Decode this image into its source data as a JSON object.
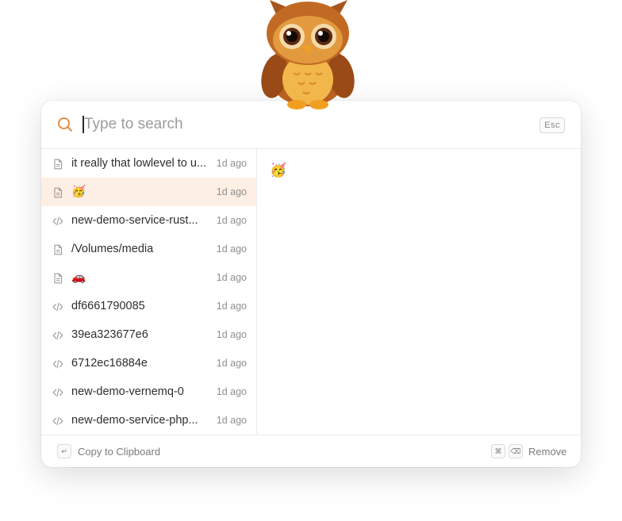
{
  "search": {
    "placeholder": "Type to search",
    "value": "",
    "esc_key": "Esc"
  },
  "list": {
    "items": [
      {
        "icon": "document-icon",
        "label": "it really that lowlevel to u...",
        "time": "1d ago",
        "selected": false
      },
      {
        "icon": "document-icon",
        "label": "🥳",
        "time": "1d ago",
        "selected": true
      },
      {
        "icon": "code-icon",
        "label": "new-demo-service-rust...",
        "time": "1d ago",
        "selected": false
      },
      {
        "icon": "document-icon",
        "label": "/Volumes/media",
        "time": "1d ago",
        "selected": false
      },
      {
        "icon": "document-icon",
        "label": "🚗",
        "time": "1d ago",
        "selected": false
      },
      {
        "icon": "code-icon",
        "label": "df6661790085",
        "time": "1d ago",
        "selected": false
      },
      {
        "icon": "code-icon",
        "label": "39ea323677e6",
        "time": "1d ago",
        "selected": false
      },
      {
        "icon": "code-icon",
        "label": "6712ec16884e",
        "time": "1d ago",
        "selected": false
      },
      {
        "icon": "code-icon",
        "label": "new-demo-vernemq-0",
        "time": "1d ago",
        "selected": false
      },
      {
        "icon": "code-icon",
        "label": "new-demo-service-php...",
        "time": "1d ago",
        "selected": false
      }
    ]
  },
  "preview": {
    "content": "🥳"
  },
  "footer": {
    "copy_key": "↵",
    "copy_label": "Copy to Clipboard",
    "remove_key_1": "⌘",
    "remove_key_2": "⌫",
    "remove_label": "Remove"
  },
  "colors": {
    "accent": "#e8832a",
    "selected_bg": "#fdefe4"
  }
}
